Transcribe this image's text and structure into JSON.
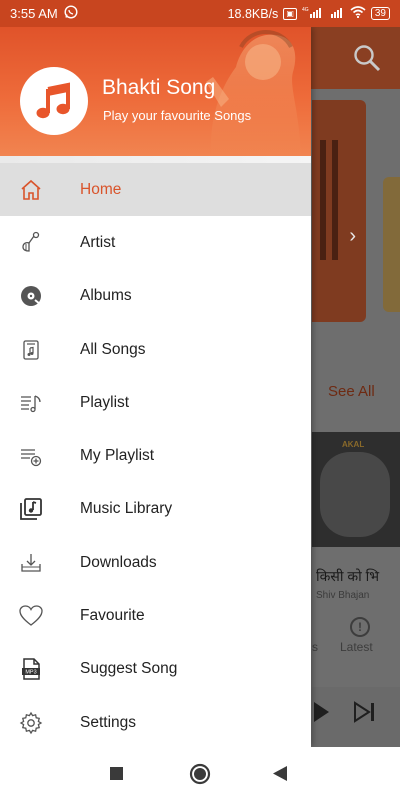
{
  "status_bar": {
    "time": "3:55 AM",
    "network_speed": "18.8KB/s",
    "network_type_top": "4G",
    "battery": "39"
  },
  "drawer": {
    "app_title": "Bhakti Song",
    "app_subtitle": "Play your favourite Songs",
    "menu": [
      {
        "label": "Home",
        "icon": "home-icon",
        "active": true
      },
      {
        "label": "Artist",
        "icon": "artist-icon"
      },
      {
        "label": "Albums",
        "icon": "albums-icon"
      },
      {
        "label": "All Songs",
        "icon": "all-songs-icon"
      },
      {
        "label": "Playlist",
        "icon": "playlist-icon"
      },
      {
        "label": "My Playlist",
        "icon": "my-playlist-icon"
      },
      {
        "label": "Music Library",
        "icon": "music-library-icon"
      },
      {
        "label": "Downloads",
        "icon": "downloads-icon"
      },
      {
        "label": "Favourite",
        "icon": "heart-icon"
      },
      {
        "label": "Suggest Song",
        "icon": "mp3-file-icon"
      },
      {
        "label": "Settings",
        "icon": "gear-icon"
      }
    ]
  },
  "background": {
    "see_all": "See All",
    "song_title": "किसी को भि",
    "song_artist": "Shiv Bhajan",
    "tab_partial": "s",
    "tab_latest": "Latest",
    "thumb_label": "AKAL"
  },
  "colors": {
    "accent": "#d9542b",
    "header_start": "#e0532a",
    "header_end": "#f18450"
  }
}
